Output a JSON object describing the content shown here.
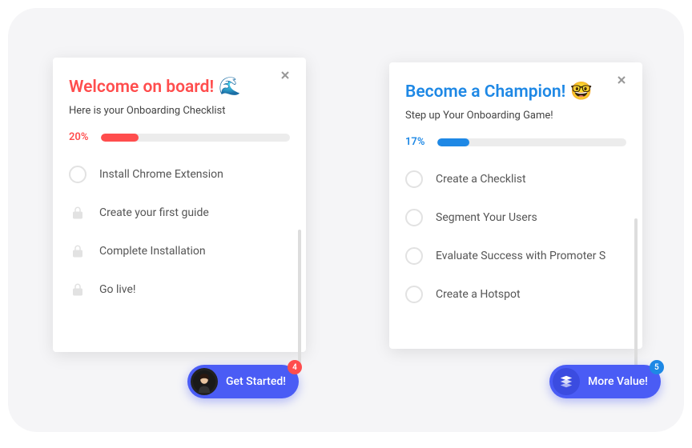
{
  "card1": {
    "title": "Welcome on board!",
    "emoji": "🌊",
    "subtitle": "Here is your Onboarding Checklist",
    "progress_pct": "20%",
    "progress_value": 20,
    "items": [
      {
        "label": "Install Chrome Extension",
        "icon": "circle"
      },
      {
        "label": "Create your first guide",
        "icon": "lock"
      },
      {
        "label": "Complete Installation",
        "icon": "lock"
      },
      {
        "label": "Go live!",
        "icon": "lock"
      }
    ],
    "cta": {
      "label": "Get Started!",
      "badge": "4"
    },
    "colors": {
      "accent": "#ff4d4d"
    }
  },
  "card2": {
    "title": "Become a Champion!",
    "emoji": "🤓",
    "subtitle": "Step up Your Onboarding Game!",
    "progress_pct": "17%",
    "progress_value": 17,
    "items": [
      {
        "label": "Create a Checklist",
        "icon": "circle"
      },
      {
        "label": "Segment Your Users",
        "icon": "circle"
      },
      {
        "label": "Evaluate Success with Promoter S",
        "icon": "circle"
      },
      {
        "label": "Create a Hotspot",
        "icon": "circle"
      }
    ],
    "cta": {
      "label": "More Value!",
      "badge": "5"
    },
    "colors": {
      "accent": "#1e88e5"
    }
  }
}
